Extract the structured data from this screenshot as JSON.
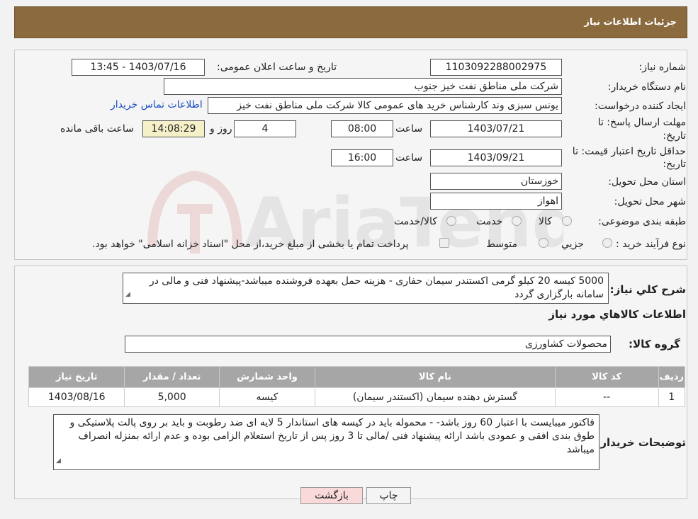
{
  "header": {
    "title": "جزئیات اطلاعات نیاز"
  },
  "form": {
    "need_number_label": "شماره نیاز:",
    "need_number": "1103092288002975",
    "announce_label": "تاریخ و ساعت اعلان عمومی:",
    "announce_value": "1403/07/16 - 13:45",
    "buyer_org_label": "نام دستگاه خریدار:",
    "buyer_org": "شرکت ملی مناطق نفت خیز جنوب",
    "creator_label": "ایجاد کننده درخواست:",
    "creator": "یونس سبزی وند کارشناس خرید های عمومی کالا شرکت ملی مناطق نفت خیز",
    "contact_link": "اطلاعات تماس خریدار",
    "deadline_label_1": "مهلت ارسال پاسخ: تا",
    "deadline_label_2": "تاریخ:",
    "deadline_date": "1403/07/21",
    "time_label": "ساعت",
    "deadline_time": "08:00",
    "days_value": "4",
    "days_label": "روز و",
    "remaining_time": "14:08:29",
    "remaining_label": "ساعت باقی مانده",
    "validity_label_1": "حداقل تاریخ اعتبار قیمت: تا",
    "validity_label_2": "تاریخ:",
    "validity_date": "1403/09/21",
    "validity_time": "16:00",
    "province_label": "استان محل تحویل:",
    "province": "خوزستان",
    "city_label": "شهر محل تحویل:",
    "city": "اهواز",
    "category_label": "طبقه بندی موضوعی:",
    "category_options": [
      "کالا",
      "خدمت",
      "کالا/خدمت"
    ],
    "process_label": "نوع فرآیند خرید :",
    "process_options": [
      "جزیي",
      "متوسط"
    ],
    "process_note": "پرداخت تمام یا بخشی از مبلغ خرید،از محل \"اسناد خزانه اسلامی\" خواهد بود."
  },
  "description": {
    "label": "شرح کلي نياز:",
    "text": "5000 کیسه 20 کیلو گرمی اکستندر سیمان حفاری - هزینه حمل بعهده فروشنده میباشد-پیشنهاد فنی  و مالی در سامانه بارگزاری گردد"
  },
  "goods": {
    "section_title": "اطلاعات کالاهاي مورد نياز",
    "group_label": "گروه کالا:",
    "group_value": "محصولات کشاورزی"
  },
  "table": {
    "headers": [
      "رديف",
      "کد کالا",
      "نام کالا",
      "واحد شمارش",
      "تعداد / مقدار",
      "تاریخ نیاز"
    ],
    "rows": [
      [
        "1",
        "--",
        "گسترش دهنده سیمان (اکستندر سیمان)",
        "کیسه",
        "5,000",
        "1403/08/16"
      ]
    ]
  },
  "buyer_notes": {
    "label": "توضیحات خریدار:",
    "text": "فاکتور میبایست با اعتبار 60 روز باشد- - محموله باید در کیسه های استاندار 5 لایه ای ضد رطوبت و باید بر روی پالت پلاستیکی و طوق بندی افقی و عمودی باشد ارائه پیشنهاد فنی /مالی تا 3 روز پس از تاریخ استعلام الزامی بوده و عدم ارائه بمنزله انصراف میباشد"
  },
  "buttons": {
    "print": "چاپ",
    "back": "بازگشت"
  },
  "watermark": {
    "text": "AriaTender.neT"
  },
  "colors": {
    "header": "#8b6a3e",
    "table_header": "#a6a6a6",
    "link": "#1a4fc4",
    "back_button": "#f9d9d9"
  }
}
